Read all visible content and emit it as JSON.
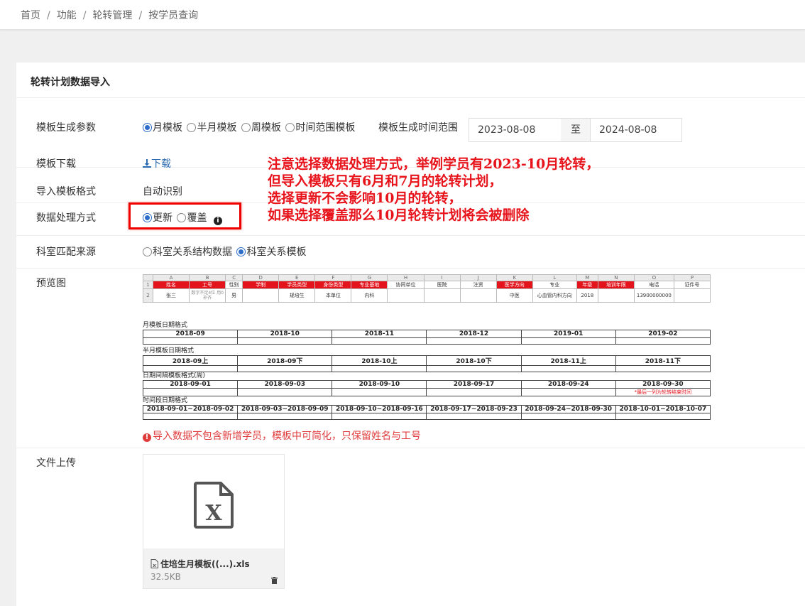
{
  "breadcrumb": [
    "首页",
    "功能",
    "轮转管理",
    "按学员查询"
  ],
  "panel": {
    "title": "轮转计划数据导入"
  },
  "template_params": {
    "label": "模板生成参数",
    "options": [
      "月模板",
      "半月模板",
      "周模板",
      "时间范围模板"
    ],
    "selected": "月模板",
    "range_label": "模板生成时间范围",
    "start_date": "2023-08-08",
    "range_sep": "至",
    "end_date": "2024-08-08"
  },
  "download": {
    "label": "模板下载",
    "link": "下载"
  },
  "import_format": {
    "label": "导入模板格式",
    "value": "自动识别"
  },
  "processing": {
    "label": "数据处理方式",
    "options": [
      "更新",
      "覆盖"
    ],
    "selected": "更新"
  },
  "dept_source": {
    "label": "科室匹配来源",
    "options": [
      "科室关系结构数据",
      "科室关系模板"
    ],
    "selected": "科室关系模板"
  },
  "preview": {
    "label": "预览图",
    "col_letters": [
      "A",
      "B",
      "C",
      "D",
      "E",
      "F",
      "G",
      "H",
      "I",
      "J",
      "K",
      "L",
      "M",
      "N",
      "O",
      "P"
    ],
    "header_row": [
      "姓名",
      "工号",
      "性别",
      "学制",
      "学员类型",
      "身份类型",
      "专业基地",
      "协同单位",
      "医院",
      "注资",
      "医学方向",
      "专业",
      "年级",
      "培训年限",
      "电话",
      "证件号"
    ],
    "red_cols": [
      0,
      1,
      3,
      4,
      5,
      6,
      10,
      12,
      13
    ],
    "data_row": [
      "张三",
      "数字不足4位 用0补齐",
      "男",
      "",
      "规培生",
      "本单位",
      "内科",
      "",
      "",
      "",
      "中医",
      "心血管内科方向",
      "2018",
      "",
      "13900000000",
      ""
    ],
    "month_title": "月模板日期格式",
    "month_dates": [
      "2018-09",
      "2018-10",
      "2018-11",
      "2018-12",
      "2019-01",
      "2019-02"
    ],
    "halfmonth_title": "半月模板日期格式",
    "halfmonth_dates": [
      "2018-09上",
      "2018-09下",
      "2018-10上",
      "2018-10下",
      "2018-11上",
      "2018-11下"
    ],
    "week_title": "日期间隔模板格式(周)",
    "week_dates": [
      "2018-09-01",
      "2018-09-03",
      "2018-09-10",
      "2018-09-17",
      "2018-09-24",
      "2018-09-30"
    ],
    "week_note": "*最后一列为轮转结束时间",
    "range_title": "时间段日期格式",
    "range_dates": [
      "2018-09-01~2018-09-02",
      "2018-09-03~2018-09-09",
      "2018-09-10~2018-09-16",
      "2018-09-17~2018-09-23",
      "2018-09-24~2018-09-30",
      "2018-10-01~2018-10-07"
    ]
  },
  "warning": "导入数据不包含新增学员，模板中可简化，只保留姓名与工号",
  "annotation": [
    "注意选择数据处理方式，举例学员有2023-10月轮转，",
    "但导入模板只有6月和7月的轮转计划，",
    "选择更新不会影响10月的轮转，",
    "如果选择覆盖那么10月轮转计划将会被删除"
  ],
  "upload": {
    "label": "文件上传",
    "file_name": "住培生月模板((...).xls",
    "file_size": "32.5KB"
  },
  "colors": {
    "accent": "#2d6cc8",
    "annotation": "#e8141c",
    "warning": "#e03c3c"
  }
}
